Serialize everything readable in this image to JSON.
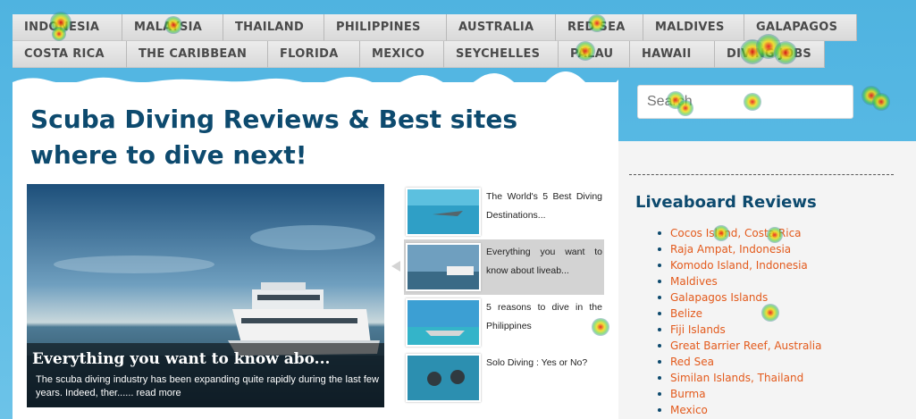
{
  "nav": {
    "row1": [
      "INDONESIA",
      "MALAYSIA",
      "THAILAND",
      "PHILIPPINES",
      "AUSTRALIA",
      "RED SEA",
      "MALDIVES",
      "GALAPAGOS"
    ],
    "row2": [
      "COSTA RICA",
      "THE CARIBBEAN",
      "FLORIDA",
      "MEXICO",
      "SEYCHELLES",
      "PALAU",
      "HAWAII",
      "DIVING JOBS"
    ]
  },
  "main": {
    "title": "Scuba Diving Reviews & Best sites where to dive next!",
    "hero": {
      "title": "Everything you want to know abo...",
      "text": "The scuba diving industry has been expanding quite rapidly during the last few years. Indeed, ther......",
      "read_more": "read more"
    },
    "thumbs": [
      {
        "text": "The World's 5 Best Diving Destinations...",
        "active": false
      },
      {
        "text": "Everything you want to know about liveab...",
        "active": true
      },
      {
        "text": "5 reasons to dive in the Philippines",
        "active": false
      },
      {
        "text": "Solo Diving : Yes or No?",
        "active": false
      }
    ]
  },
  "sidebar": {
    "search_placeholder": "Search",
    "heading": "Liveaboard Reviews",
    "reviews": [
      "Cocos Island, Costa Rica",
      "Raja Ampat, Indonesia",
      "Komodo Island, Indonesia",
      "Maldives",
      "Galapagos Islands",
      "Belize",
      "Fiji Islands",
      "Great Barrier Reef, Australia",
      "Red Sea",
      "Similan Islands, Thailand",
      "Burma",
      "Mexico"
    ]
  },
  "colors": {
    "sky": "#58b9e4",
    "title": "#0d4a6e",
    "link": "#e35a1c",
    "nav_bg": "#e3e3e3"
  }
}
